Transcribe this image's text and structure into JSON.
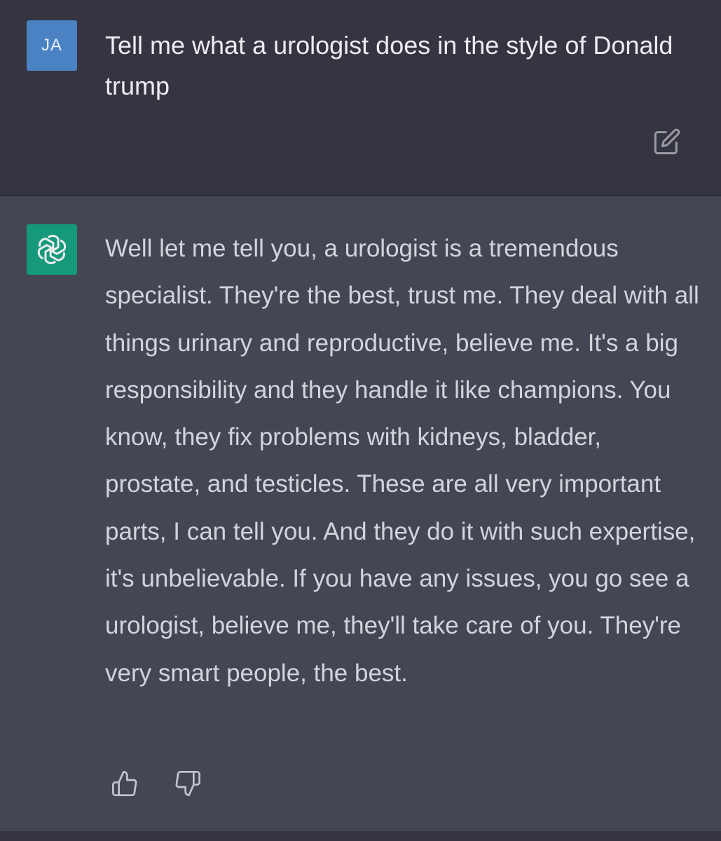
{
  "user_message": {
    "avatar_initials": "JA",
    "text": "Tell me what a urologist does in the style of Donald trump",
    "edit_icon": "edit-icon"
  },
  "assistant_message": {
    "avatar_icon": "openai-logo-icon",
    "text": "Well let me tell you, a urologist is a tremendous specialist. They're the best, trust me. They deal with all things urinary and reproductive, believe me. It's a big responsibility and they handle it like champions. You know, they fix problems with kidneys, bladder, prostate, and testicles. These are all very important parts, I can tell you. And they do it with such expertise, it's unbelievable. If you have any issues, you go see a urologist, believe me, they'll take care of you. They're very smart people, the best.",
    "feedback_icons": [
      "thumbs-up-icon",
      "thumbs-down-icon"
    ]
  },
  "colors": {
    "user_bg": "#343541",
    "assistant_bg": "#444654",
    "user_avatar": "#4b82c4",
    "bot_avatar": "#10a37f",
    "text_primary": "#ececf1",
    "text_secondary": "#d1d5db"
  }
}
